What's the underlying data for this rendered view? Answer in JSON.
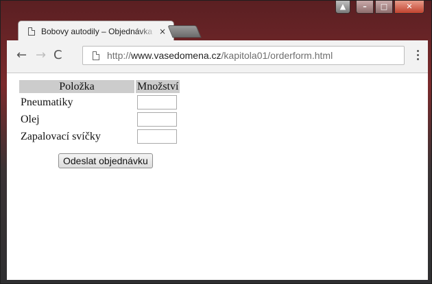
{
  "tab": {
    "title": "Bobovy autodily – Objednávka",
    "close": "×"
  },
  "toolbar": {
    "back": "←",
    "forward": "→",
    "reload": "C"
  },
  "address": {
    "protocol": "http://",
    "host": "www.vasedomena.cz",
    "path": "/kapitola01/orderform.html"
  },
  "form": {
    "headers": [
      "Položka",
      "Množství"
    ],
    "rows": [
      {
        "label": "Pneumatiky",
        "value": ""
      },
      {
        "label": "Olej",
        "value": ""
      },
      {
        "label": "Zapalovací svíčky",
        "value": ""
      }
    ],
    "submit_label": "Odeslat objednávku"
  },
  "colors": {
    "header_bg": "#cccccc",
    "frame": "#6b2a2c",
    "close_button": "#c2432f"
  }
}
